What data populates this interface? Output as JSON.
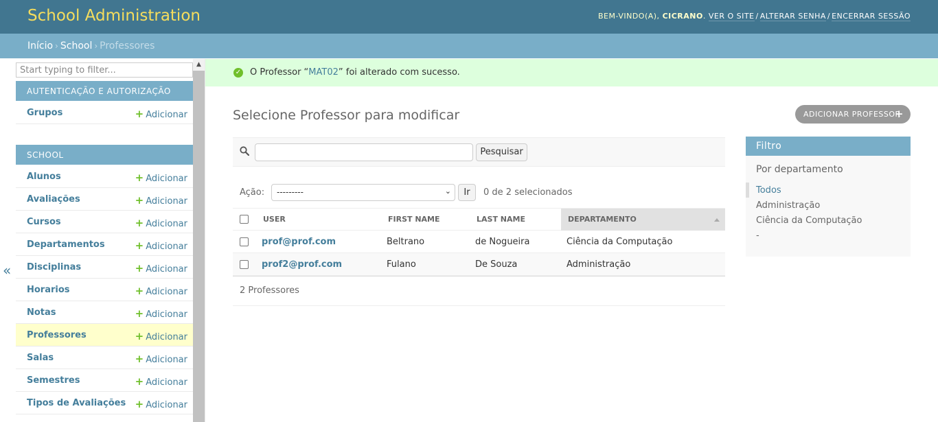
{
  "header": {
    "site_name": "School Administration",
    "welcome": "Bem-vindo(a),",
    "username": "Cicrano",
    "view_site": "Ver o site",
    "change_password": "Alterar senha",
    "logout": "Encerrar sessão"
  },
  "breadcrumbs": {
    "home": "Início",
    "app": "School",
    "current": "Professores"
  },
  "sidebar": {
    "filter_placeholder": "Start typing to filter...",
    "toggle_label": "«",
    "add_label": "Adicionar",
    "auth_module": {
      "caption": "Autenticação e Autorização",
      "items": [
        {
          "name": "Grupos"
        }
      ]
    },
    "school_module": {
      "caption": "School",
      "items": [
        {
          "name": "Alunos"
        },
        {
          "name": "Avaliações"
        },
        {
          "name": "Cursos"
        },
        {
          "name": "Departamentos"
        },
        {
          "name": "Disciplinas"
        },
        {
          "name": "Horarios"
        },
        {
          "name": "Notas"
        },
        {
          "name": "Professores",
          "current": true
        },
        {
          "name": "Salas"
        },
        {
          "name": "Semestres"
        },
        {
          "name": "Tipos de Avaliações"
        }
      ]
    }
  },
  "message": {
    "prefix": "O Professor “",
    "object_link": "MAT02",
    "suffix": "” foi alterado com sucesso."
  },
  "content": {
    "title": "Selecione Professor para modificar",
    "add_button": "Adicionar Professor",
    "search_value": "",
    "search_button": "Pesquisar",
    "action_label": "Ação:",
    "action_selected": "---------",
    "go_button": "Ir",
    "selection_counter": "0 de 2 selecionados",
    "columns": [
      "User",
      "First name",
      "Last name",
      "Departamento"
    ],
    "rows": [
      {
        "user": "prof@prof.com",
        "first_name": "Beltrano",
        "last_name": "de Nogueira",
        "departamento": "Ciência da Computação"
      },
      {
        "user": "prof2@prof.com",
        "first_name": "Fulano",
        "last_name": "De Souza",
        "departamento": "Administração"
      }
    ],
    "paginator": "2 Professores"
  },
  "filter": {
    "title": "Filtro",
    "by": "Por departamento",
    "options": [
      "Todos",
      "Administração",
      "Ciência da Computação",
      "-"
    ],
    "selected": "Todos"
  }
}
